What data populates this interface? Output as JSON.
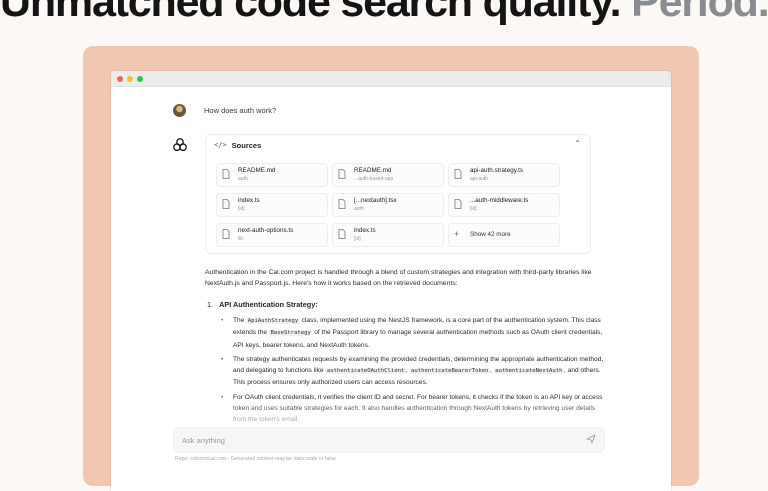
{
  "headline": {
    "main": "Unmatched code search quality.",
    "muted": "Period."
  },
  "chat": {
    "question": "How does auth work?"
  },
  "sources": {
    "title": "Sources",
    "items": [
      {
        "name": "README.md",
        "repo": "auth"
      },
      {
        "name": "README.md",
        "repo": "...auth-based-app"
      },
      {
        "name": "api-auth.strategy.ts",
        "repo": "api-auth"
      },
      {
        "name": "index.ts",
        "repo": "[id]"
      },
      {
        "name": "[...nextauth].tsx",
        "repo": "auth"
      },
      {
        "name": "...auth-middleware.ts",
        "repo": "[id]"
      },
      {
        "name": "next-auth-options.ts",
        "repo": "lib"
      },
      {
        "name": "index.ts",
        "repo": "[id]"
      }
    ],
    "more_label": "Show 42 more"
  },
  "answer": {
    "intro": "Authentication in the Cal.com project is handled through a blend of custom strategies and integration with third-party libraries like NextAuth.js and Passport.js. Here's how it works based on the retrieved documents:",
    "section_number": "1.",
    "section_title": "API Authentication Strategy:",
    "b1_t1": "The ",
    "b1_c1": "ApiAuthStrategy",
    "b1_t2": " class, implemented using the NestJS framework, is a core part of the authentication system. This class extends the ",
    "b1_c2": "BaseStrategy",
    "b1_t3": " of the Passport library to manage several authentication methods such as OAuth client credentials, API keys, bearer tokens, and NextAuth tokens.",
    "b2_t1": "The strategy authenticates requests by examining the provided credentials, determining the appropriate authentication method, and delegating to functions like ",
    "b2_c1": "authenticateOAuthClient",
    "b2_t2": ", ",
    "b2_c2": "authenticateBearerToken",
    "b2_t3": ", ",
    "b2_c3": "authenticateNextAuth",
    "b2_t4": ", and others. This process ensures only authorized users can access resources.",
    "b3_t1": "For OAuth client credentials, it verifies the client ID and secret. For bearer tokens, it checks if the token is an API key or access token and uses suitable strategies for each. It also handles authentication through NextAuth tokens by retrieving user details from the token's email."
  },
  "input": {
    "placeholder": "Ask anything"
  },
  "footer": {
    "text": "Repo: calcom/cal.com · Generated content may be inaccurate or false"
  },
  "icons": {
    "user": "avatar",
    "assistant": "trefoil-logo-icon",
    "sources": "code-brackets-icon",
    "collapse": "chevron-up-icon",
    "file": "file-icon",
    "more": "plus-icon",
    "send": "send-icon"
  },
  "colors": {
    "frame": "#f1c7b2",
    "background": "#fbf8f5",
    "muted_headline": "#8a8c92"
  }
}
